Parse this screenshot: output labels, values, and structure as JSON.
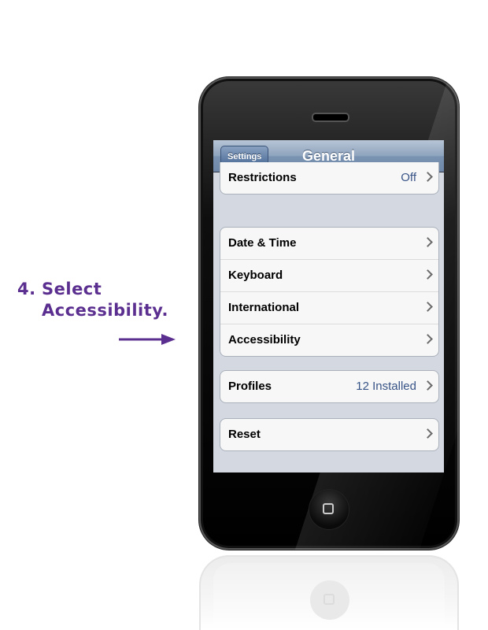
{
  "instruction": {
    "number": "4.",
    "line1": "Select",
    "line2": "Accessibility."
  },
  "colors": {
    "instruction": "#5b2f8f",
    "value_text": "#385487"
  },
  "navbar": {
    "back_label": "Settings",
    "title": "General"
  },
  "groups": {
    "restrictions": {
      "label": "Restrictions",
      "value": "Off"
    },
    "system": {
      "date_time": "Date & Time",
      "keyboard": "Keyboard",
      "international": "International",
      "accessibility": "Accessibility"
    },
    "profiles": {
      "label": "Profiles",
      "value": "12 Installed"
    },
    "reset": {
      "label": "Reset"
    }
  },
  "icons": {
    "row_disclosure": "chevron-right-icon",
    "home": "home-square-icon",
    "arrow": "arrow-right-icon"
  }
}
